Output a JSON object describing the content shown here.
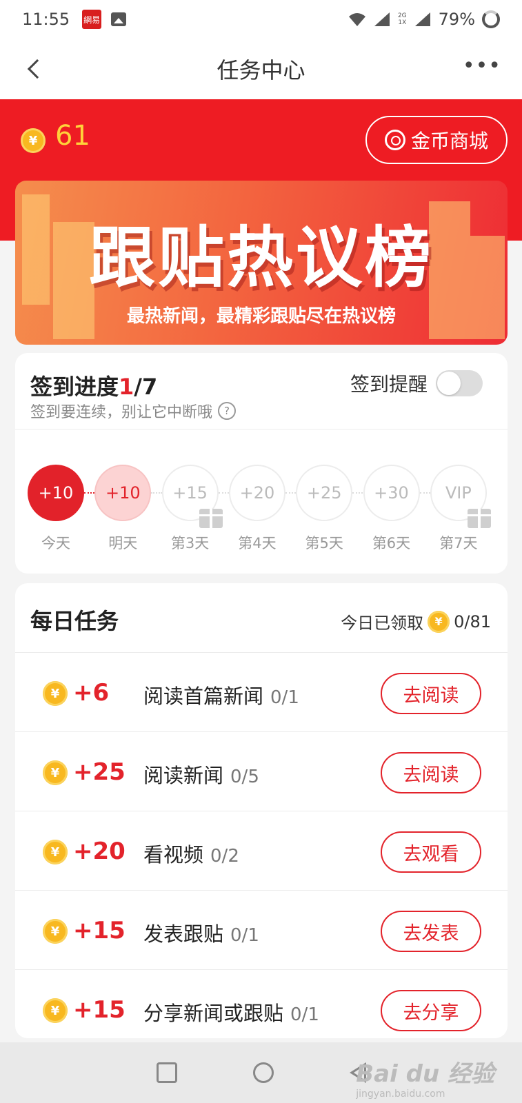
{
  "status_bar": {
    "time": "11:55",
    "app_badge": "網易",
    "network_top": "2G",
    "network_bottom": "1X",
    "battery": "79%"
  },
  "nav": {
    "title": "任务中心",
    "more": "•••"
  },
  "header": {
    "coin_balance": "61",
    "coin_symbol": "¥",
    "shop_label": "金币商城"
  },
  "banner": {
    "title": "跟贴热议榜",
    "subtitle": "最热新闻，最精彩跟贴尽在热议榜"
  },
  "checkin": {
    "title_prefix": "签到进度",
    "progress_current": "1",
    "progress_total": "/7",
    "description": "签到要连续，别让它中断哦",
    "help_icon": "?",
    "reminder_label": "签到提醒",
    "reminder_on": false,
    "days": [
      {
        "reward": "+10",
        "label": "今天",
        "state": "today",
        "gift": false
      },
      {
        "reward": "+10",
        "label": "明天",
        "state": "tomorrow",
        "gift": false
      },
      {
        "reward": "+15",
        "label": "第3天",
        "state": "future",
        "gift": true
      },
      {
        "reward": "+20",
        "label": "第4天",
        "state": "future",
        "gift": false
      },
      {
        "reward": "+25",
        "label": "第5天",
        "state": "future",
        "gift": false
      },
      {
        "reward": "+30",
        "label": "第6天",
        "state": "future",
        "gift": false
      },
      {
        "reward": "VIP",
        "label": "第7天",
        "state": "future",
        "gift": true
      }
    ]
  },
  "daily_tasks": {
    "title": "每日任务",
    "summary_label": "今日已领取",
    "summary_value": "0/81",
    "coin_symbol": "¥",
    "items": [
      {
        "reward": "+6",
        "name": "阅读首篇新闻",
        "progress": "0/1",
        "button": "去阅读"
      },
      {
        "reward": "+25",
        "name": "阅读新闻",
        "progress": "0/5",
        "button": "去阅读"
      },
      {
        "reward": "+20",
        "name": "看视频",
        "progress": "0/2",
        "button": "去观看"
      },
      {
        "reward": "+15",
        "name": "发表跟贴",
        "progress": "0/1",
        "button": "去发表"
      },
      {
        "reward": "+15",
        "name": "分享新闻或跟贴",
        "progress": "0/1",
        "button": "去分享"
      }
    ]
  },
  "watermark": {
    "text": "Bai du 经验",
    "sub": "jingyan.baidu.com"
  },
  "colors": {
    "brand_red": "#ee1c23",
    "coin_gold": "#f8b820",
    "accent_red": "#e3232b"
  }
}
